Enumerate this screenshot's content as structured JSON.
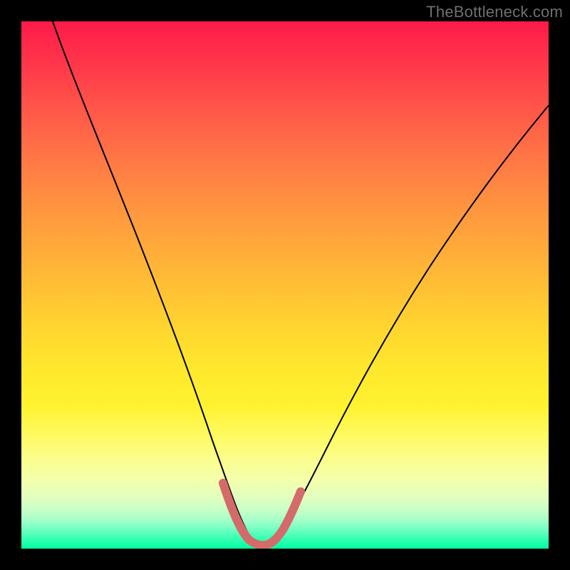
{
  "watermark": {
    "text": "TheBottleneck.com"
  },
  "chart_data": {
    "type": "line",
    "title": "",
    "xlabel": "",
    "ylabel": "",
    "xlim": [
      0,
      100
    ],
    "ylim": [
      0,
      100
    ],
    "grid": false,
    "legend": false,
    "background_gradient": {
      "type": "vertical",
      "stops": [
        {
          "pos": 0,
          "color": "#ff1a49"
        },
        {
          "pos": 50,
          "color": "#ffd52f"
        },
        {
          "pos": 80,
          "color": "#fefb66"
        },
        {
          "pos": 95,
          "color": "#7cffc4"
        },
        {
          "pos": 100,
          "color": "#03ff9f"
        }
      ]
    },
    "series": [
      {
        "name": "bottleneck-curve",
        "color": "#000000",
        "stroke_width": 2,
        "x": [
          6,
          10,
          15,
          20,
          25,
          30,
          33,
          36,
          38,
          40,
          42,
          44,
          46,
          48,
          52,
          55,
          60,
          65,
          70,
          75,
          80,
          85,
          90,
          95,
          100
        ],
        "y": [
          100,
          90,
          78,
          66,
          54,
          40,
          30,
          20,
          12,
          6,
          2,
          1,
          1,
          2,
          6,
          12,
          20,
          28,
          35,
          42,
          48,
          54,
          60,
          65,
          70
        ]
      },
      {
        "name": "near-minimum-highlight",
        "color": "#d46a6a",
        "stroke_width": 10,
        "x": [
          38,
          40,
          42,
          44,
          46,
          48,
          50,
          52
        ],
        "y": [
          11,
          5,
          2,
          1,
          1,
          2,
          4,
          8
        ]
      }
    ],
    "note": "y values represent percentage height from bottom; curve shows a V-shaped bottleneck profile with minimum around x≈44–46."
  }
}
